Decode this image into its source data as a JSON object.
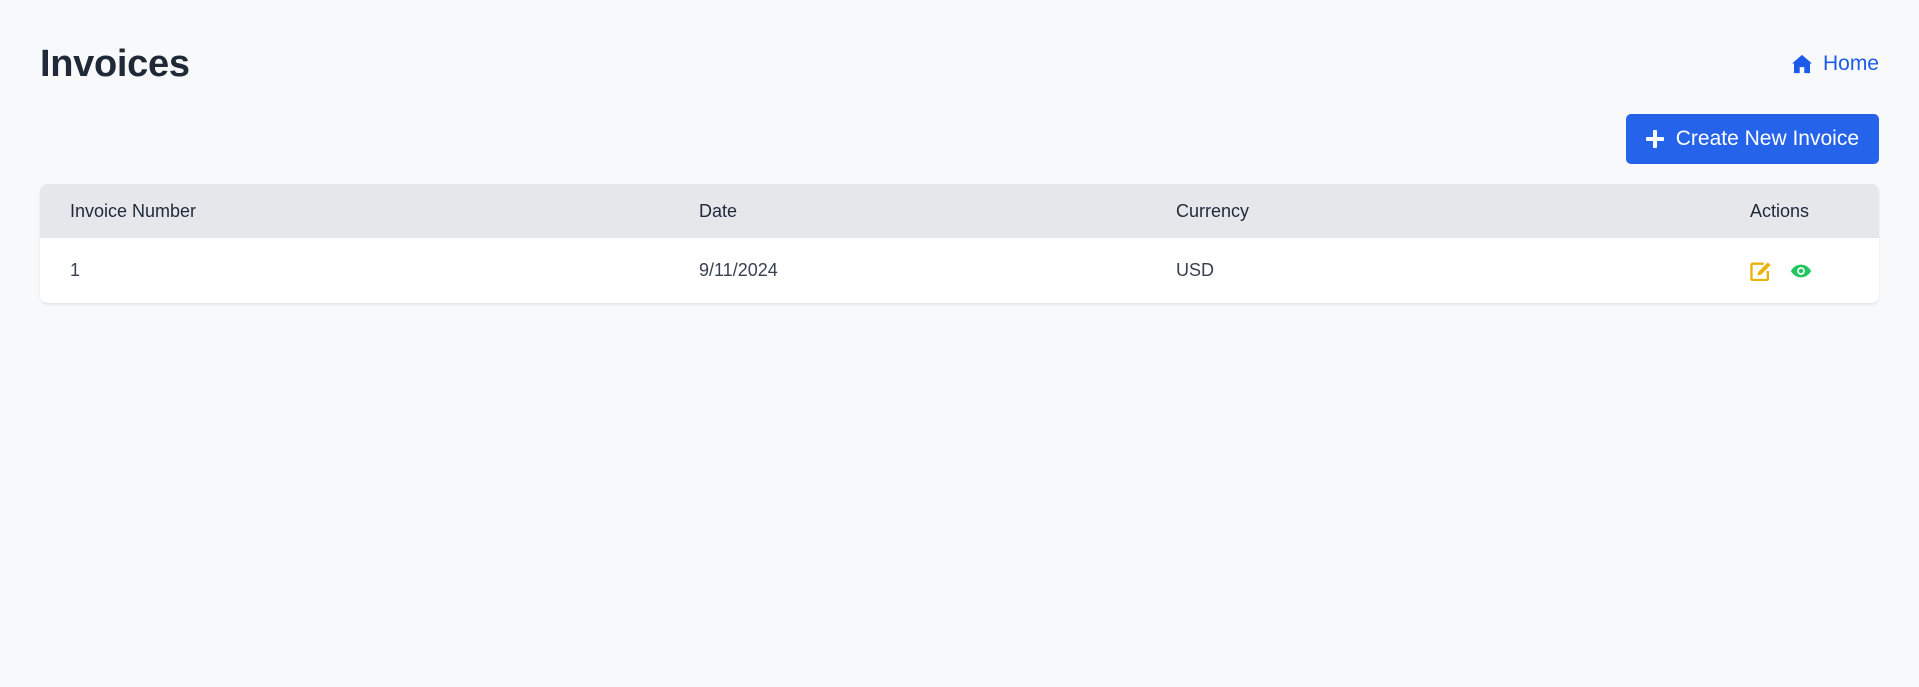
{
  "header": {
    "title": "Invoices",
    "home_label": "Home"
  },
  "toolbar": {
    "create_label": "Create New Invoice"
  },
  "table": {
    "columns": [
      "Invoice Number",
      "Date",
      "Currency",
      "Actions"
    ],
    "rows": [
      {
        "invoice_number": "1",
        "date": "9/11/2024",
        "currency": "USD",
        "actions": [
          "edit-icon",
          "eye-icon"
        ]
      }
    ]
  },
  "colors": {
    "background": "#f8f9fb",
    "accent": "#2563eb",
    "link": "#1d5ae8",
    "edit_icon": "#eab308",
    "view_icon": "#22c55e",
    "header_row": "#e5e7eb"
  },
  "icons": {
    "home": "home-icon",
    "create": "plus-icon"
  }
}
